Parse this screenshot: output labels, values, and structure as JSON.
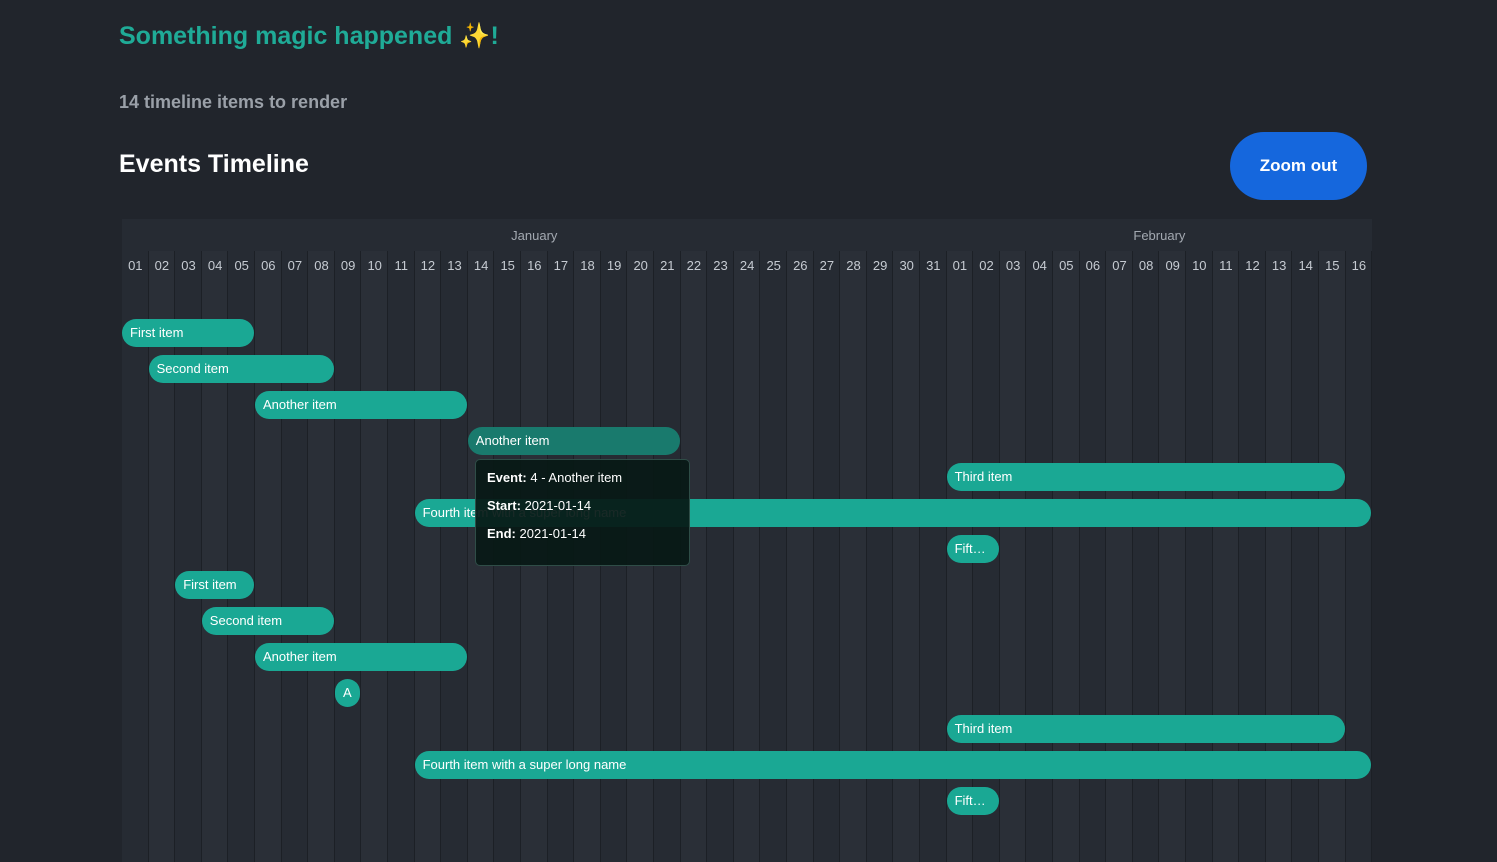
{
  "header": {
    "magic_text": "Something magic happened ✨!",
    "count_text": "14 timeline items to render",
    "title": "Events Timeline",
    "zoom_label": "Zoom out"
  },
  "timeline": {
    "months": [
      "January",
      "February"
    ],
    "days": [
      "01",
      "02",
      "03",
      "04",
      "05",
      "06",
      "07",
      "08",
      "09",
      "10",
      "11",
      "12",
      "13",
      "14",
      "15",
      "16",
      "17",
      "18",
      "19",
      "20",
      "21",
      "22",
      "23",
      "24",
      "25",
      "26",
      "27",
      "28",
      "29",
      "30",
      "31",
      "01",
      "02",
      "03",
      "04",
      "05",
      "06",
      "07",
      "08",
      "09",
      "10",
      "11",
      "12",
      "13",
      "14",
      "15",
      "16"
    ],
    "items": [
      {
        "label": "First item",
        "start": "2021-01-01",
        "end": "2021-01-05",
        "row": 0
      },
      {
        "label": "Second item",
        "start": "2021-01-02",
        "end": "2021-01-08",
        "row": 1
      },
      {
        "label": "Another item",
        "start": "2021-01-06",
        "end": "2021-01-13",
        "row": 2
      },
      {
        "label": "Another item",
        "start": "2021-01-14",
        "end": "2021-01-21",
        "row": 3,
        "active": true
      },
      {
        "label": "Third item",
        "start": "2021-02-01",
        "end": "2021-02-15",
        "row": 4
      },
      {
        "label": "Fourth item with a super long name",
        "start": "2021-01-12",
        "end": "2021-02-16",
        "row": 5
      },
      {
        "label": "Fifth item",
        "display_label": "Fift…",
        "start": "2021-02-01",
        "end": "2021-02-02",
        "row": 6
      },
      {
        "label": "First item",
        "start": "2021-01-03",
        "end": "2021-01-05",
        "row": 7
      },
      {
        "label": "Second item",
        "start": "2021-01-04",
        "end": "2021-01-08",
        "row": 8
      },
      {
        "label": "Another item",
        "start": "2021-01-06",
        "end": "2021-01-13",
        "row": 9
      },
      {
        "label": "A",
        "start": "2021-01-09",
        "end": "2021-01-09",
        "row": 10,
        "circle": true
      },
      {
        "label": "Third item",
        "start": "2021-02-01",
        "end": "2021-02-15",
        "row": 11
      },
      {
        "label": "Fourth item with a super long name",
        "start": "2021-01-12",
        "end": "2021-02-16",
        "row": 12
      },
      {
        "label": "Fifth item",
        "display_label": "Fift…",
        "start": "2021-02-01",
        "end": "2021-02-02",
        "row": 13
      }
    ]
  },
  "tooltip": {
    "event_label": "Event:",
    "event_value": "4 - Another item",
    "start_label": "Start:",
    "start_value": "2021-01-14",
    "end_label": "End:",
    "end_value": "2021-01-14"
  },
  "colors": {
    "accent": "#1fab97",
    "item": "#1aa894",
    "item_active": "#197a6d",
    "button": "#1567dd",
    "background": "#21252c"
  }
}
